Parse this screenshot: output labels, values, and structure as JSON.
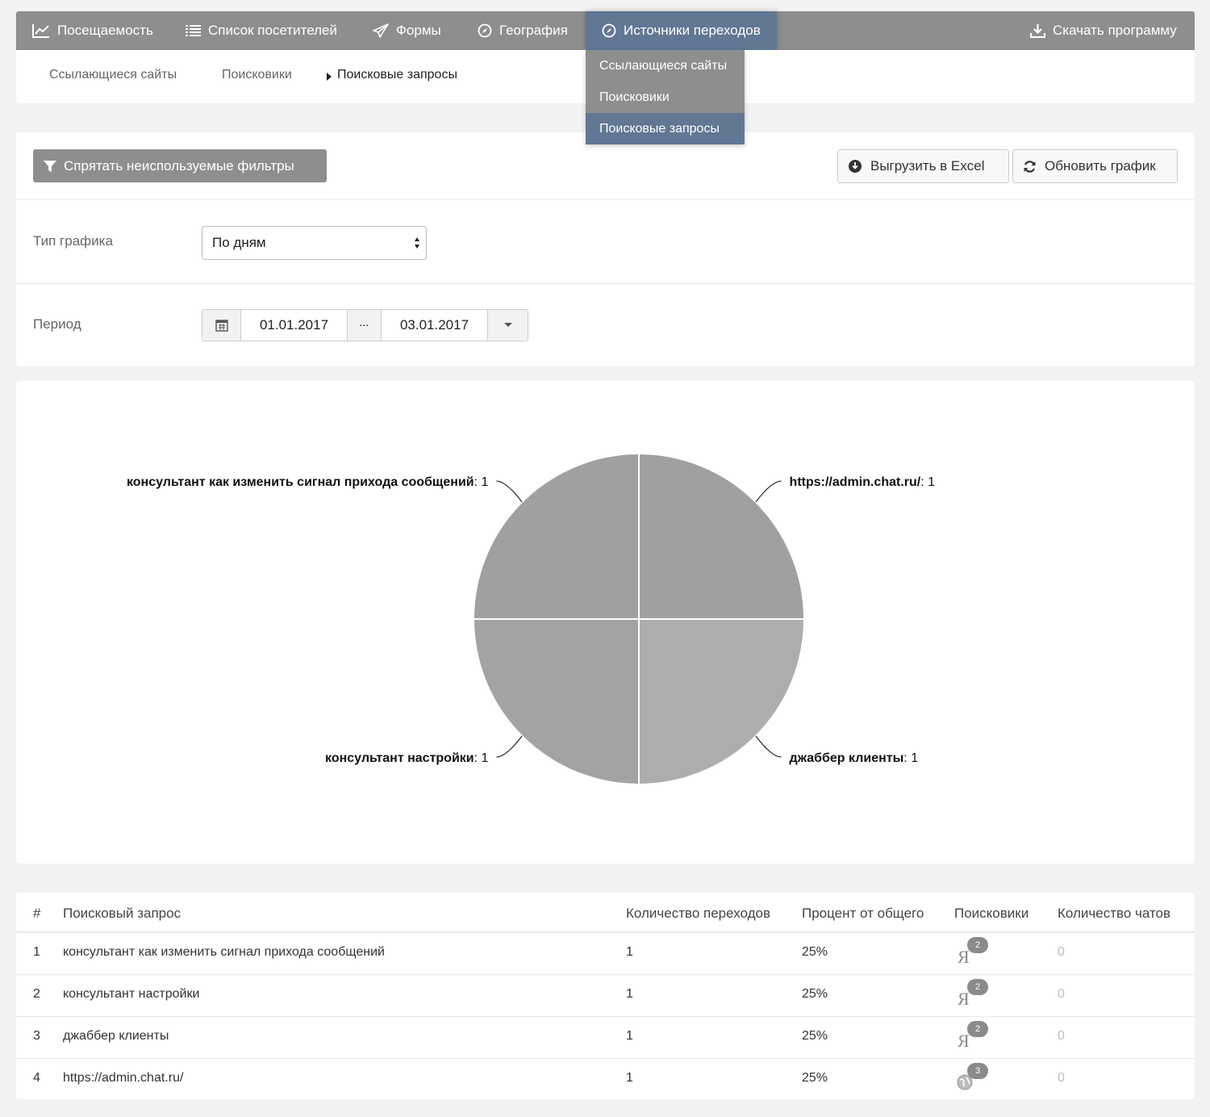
{
  "nav": {
    "items": [
      {
        "label": "Посещаемость",
        "icon": "line-chart-icon"
      },
      {
        "label": "Список посетителей",
        "icon": "list-icon"
      },
      {
        "label": "Формы",
        "icon": "paper-plane-icon"
      },
      {
        "label": "География",
        "icon": "compass-icon"
      },
      {
        "label": "Источники переходов",
        "icon": "compass-circle-icon",
        "active": true
      }
    ],
    "download": {
      "label": "Скачать программу",
      "icon": "download-icon"
    }
  },
  "dropdown": {
    "items": [
      "Ссылающиеся сайты",
      "Поисковики",
      "Поисковые запросы"
    ],
    "selected": "Поисковые запросы"
  },
  "subnav": {
    "items": [
      "Ссылающиеся сайты",
      "Поисковики",
      "Поисковые запросы"
    ],
    "current": "Поисковые запросы"
  },
  "filters": {
    "hide_button": "Спрятать неиспользуемые фильтры",
    "export_button": "Выгрузить в Excel",
    "refresh_button": "Обновить график",
    "chart_type_label": "Тип графика",
    "chart_type_value": "По дням",
    "period_label": "Период",
    "date_from": "01.01.2017",
    "date_sep": "···",
    "date_to": "03.01.2017"
  },
  "chart_data": {
    "type": "pie",
    "slices": [
      {
        "label": "https://admin.chat.ru/",
        "value": 1,
        "color": "#a0a0a0"
      },
      {
        "label": "джаббер клиенты",
        "value": 1,
        "color": "#adadad"
      },
      {
        "label": "консультант настройки",
        "value": 1,
        "color": "#a3a3a3"
      },
      {
        "label": "консультант как изменить сигнал прихода сообщений",
        "value": 1,
        "color": "#a0a0a0"
      }
    ]
  },
  "table": {
    "headers": [
      "#",
      "Поисковый запрос",
      "Количество переходов",
      "Процент от общего",
      "Поисковики",
      "Количество чатов"
    ],
    "rows": [
      {
        "n": "1",
        "query": "консультант как изменить сигнал прихода сообщений",
        "visits": "1",
        "percent": "25%",
        "engine": "yandex-icon",
        "engine_count": "2",
        "chats": "0"
      },
      {
        "n": "2",
        "query": "консультант настройки",
        "visits": "1",
        "percent": "25%",
        "engine": "yandex-icon",
        "engine_count": "2",
        "chats": "0"
      },
      {
        "n": "3",
        "query": "джаббер клиенты",
        "visits": "1",
        "percent": "25%",
        "engine": "yandex-icon",
        "engine_count": "2",
        "chats": "0"
      },
      {
        "n": "4",
        "query": "https://admin.chat.ru/",
        "visits": "1",
        "percent": "25%",
        "engine": "globe-icon",
        "engine_count": "3",
        "chats": "0"
      }
    ]
  }
}
